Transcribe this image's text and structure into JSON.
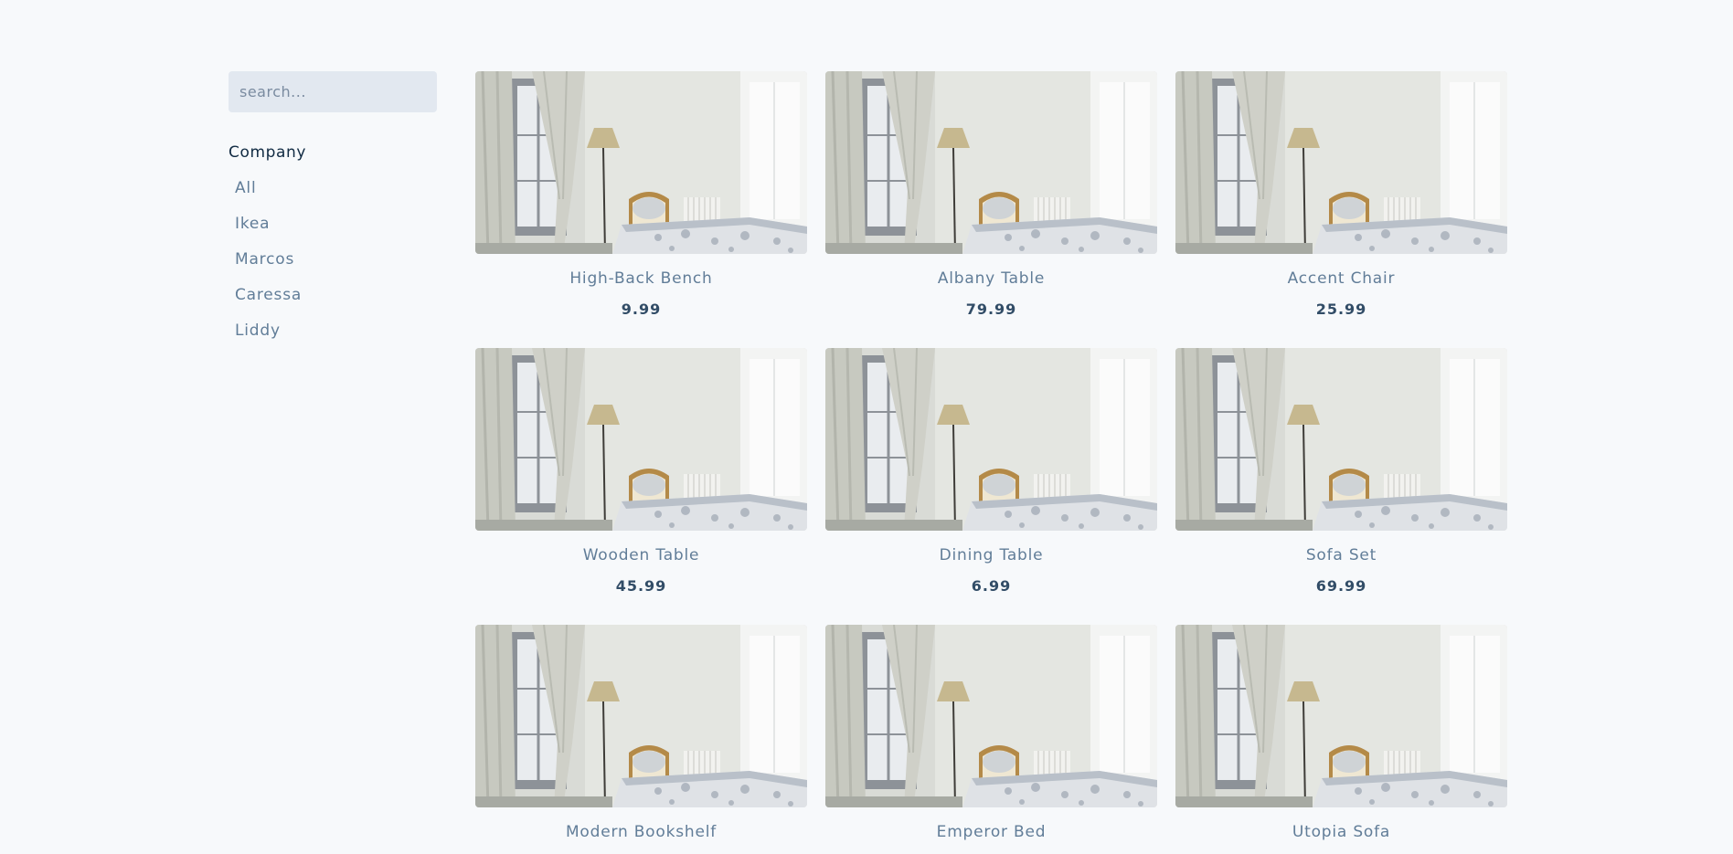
{
  "sidebar": {
    "search": {
      "placeholder": "search...",
      "value": ""
    },
    "company_title": "Company",
    "companies": [
      "All",
      "Ikea",
      "Marcos",
      "Caressa",
      "Liddy"
    ]
  },
  "products": [
    {
      "name": "High-Back Bench",
      "price": "9.99"
    },
    {
      "name": "Albany Table",
      "price": "79.99"
    },
    {
      "name": "Accent Chair",
      "price": "25.99"
    },
    {
      "name": "Wooden Table",
      "price": "45.99"
    },
    {
      "name": "Dining Table",
      "price": "6.99"
    },
    {
      "name": "Sofa Set",
      "price": "69.99"
    },
    {
      "name": "Modern Bookshelf",
      "price": ""
    },
    {
      "name": "Emperor Bed",
      "price": ""
    },
    {
      "name": "Utopia Sofa",
      "price": ""
    }
  ],
  "product_image": {
    "subject": "bedroom-photo"
  },
  "colors": {
    "background": "#f7f9fb",
    "search_bg": "#e2e8f0",
    "text": "#617d98",
    "price_text": "#324d67",
    "heading": "#102a42"
  }
}
